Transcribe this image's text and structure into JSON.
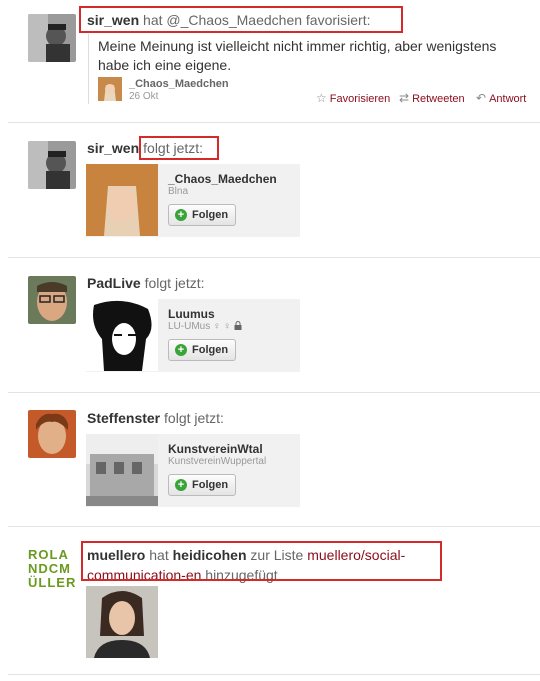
{
  "item1": {
    "user": "sir_wen",
    "verb": "hat",
    "target": "@_Chaos_Maedchen",
    "action": "favorisiert:",
    "tweet_text_line1": "Meine Meinung ist vielleicht nicht immer richtig, aber wenigstens",
    "tweet_text_line2": "habe ich eine eigene.",
    "author": "_Chaos_Maedchen",
    "date": "26 Okt",
    "actions": {
      "favorite": "Favorisieren",
      "retweet": "Retweeten",
      "reply": "Antwort"
    }
  },
  "item2": {
    "user": "sir_wen",
    "action": "folgt jetzt:",
    "card_name": "_Chaos_Maedchen",
    "card_sub": "Blna",
    "follow_label": "Folgen"
  },
  "item3": {
    "user": "PadLive",
    "action": "folgt jetzt:",
    "card_name": "Luumus",
    "card_sub": "LU-UMus ♀ ♀",
    "follow_label": "Folgen"
  },
  "item4": {
    "user": "Steffenster",
    "action": "folgt jetzt:",
    "card_name": "KunstvereinWtal",
    "card_sub": "KunstvereinWuppertal",
    "follow_label": "Folgen"
  },
  "item5": {
    "logo_lines": [
      "ROLA",
      "NDCM",
      "ÜLLER"
    ],
    "user": "muellero",
    "verb": "hat",
    "target_user": "heidicohen",
    "mid": "zur Liste",
    "list_line1": "muellero/social-",
    "list_line2": "communication-en",
    "suffix": "hinzugefügt"
  },
  "colors": {
    "link": "#8b0d1a",
    "highlight": "#d42a2a",
    "follow_plus": "#3aa33a",
    "logo": "#6a9a1e"
  }
}
